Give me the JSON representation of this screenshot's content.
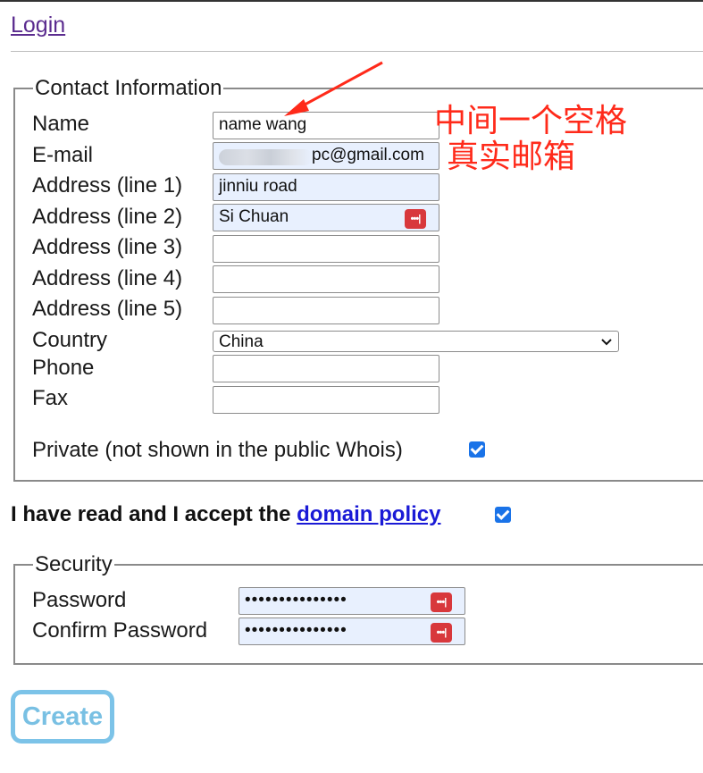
{
  "header": {
    "login_link": "Login"
  },
  "contact": {
    "legend": "Contact Information",
    "labels": {
      "name": "Name",
      "email": "E-mail",
      "address1": "Address (line 1)",
      "address2": "Address (line 2)",
      "address3": "Address (line 3)",
      "address4": "Address (line 4)",
      "address5": "Address (line 5)",
      "country": "Country",
      "phone": "Phone",
      "fax": "Fax",
      "private": "Private (not shown in the public Whois)"
    },
    "values": {
      "name": "name wang",
      "email_visible": "pc@gmail.com",
      "address1": "jinniu road",
      "address2": "Si Chuan",
      "address3": "",
      "address4": "",
      "address5": "",
      "country": "China",
      "phone": "",
      "fax": ""
    },
    "private_checked": true
  },
  "policy": {
    "text": "I have read and I accept the ",
    "link": "domain policy",
    "checked": true
  },
  "security": {
    "legend": "Security",
    "labels": {
      "password": "Password",
      "confirm": "Confirm Password"
    },
    "values": {
      "password": "•••••••••••••••",
      "confirm": "•••••••••••••••"
    }
  },
  "actions": {
    "create": "Create"
  },
  "annotations": {
    "line1": "中间一个空格",
    "line2": "真实邮箱"
  },
  "colors": {
    "annotation": "#ff2a1a",
    "autofill_bg": "#e8f0fe",
    "checkbox": "#1a73e8",
    "link": "#1a1ad6",
    "create_border": "#7cc3e8"
  },
  "icons": {
    "password_manager": "password-key-icon",
    "dropdown": "chevron-down-icon",
    "arrow": "annotation-arrow-icon"
  }
}
